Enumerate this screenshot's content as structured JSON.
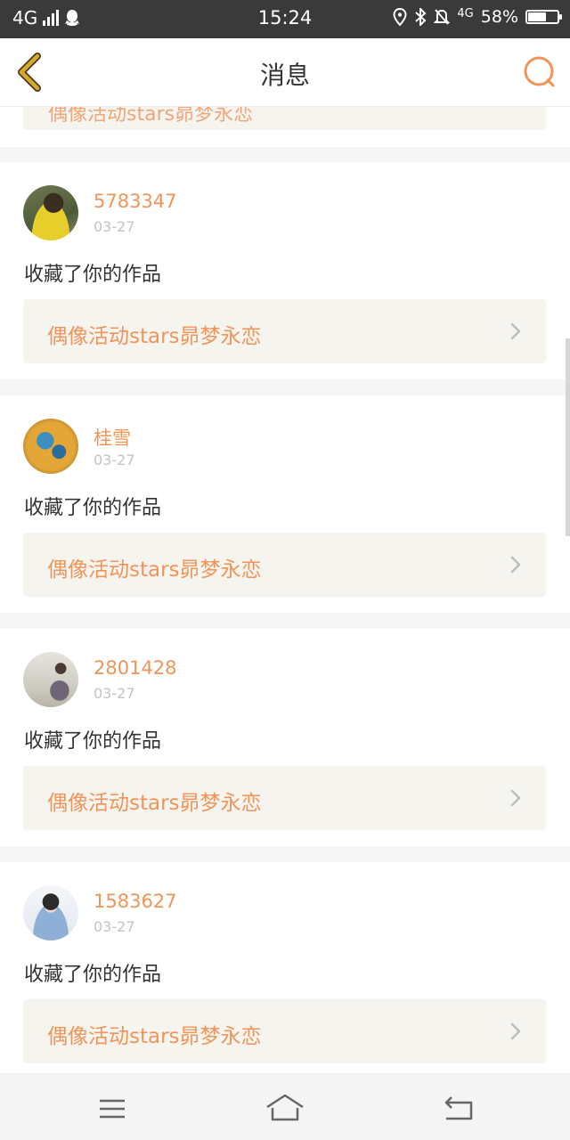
{
  "status_bar": {
    "network": "4G",
    "time": "15:24",
    "network_right": "4G",
    "battery": "58%",
    "battery_level": 0.58,
    "icons": [
      "signal-icon",
      "qq-icon",
      "location-icon",
      "bluetooth-icon",
      "bell-off-icon",
      "battery-icon"
    ]
  },
  "nav": {
    "title": "消息",
    "back_icon": "chevron-left-icon",
    "search_icon": "search-icon"
  },
  "partial_item": {
    "link_text": "偶像活动stars昴梦永恋"
  },
  "messages": [
    {
      "username": "5783347",
      "date": "03-27",
      "action": "收藏了你的作品",
      "link": "偶像活动stars昴梦永恋"
    },
    {
      "username": "桂雪",
      "date": "03-27",
      "action": "收藏了你的作品",
      "link": "偶像活动stars昴梦永恋"
    },
    {
      "username": "2801428",
      "date": "03-27",
      "action": "收藏了你的作品",
      "link": "偶像活动stars昴梦永恋"
    },
    {
      "username": "1583627",
      "date": "03-27",
      "action": "收藏了你的作品",
      "link": "偶像活动stars昴梦永恋"
    }
  ],
  "colors": {
    "accent": "#f0955a",
    "link_bg": "#f5f4ee",
    "back_icon": "#d4a92c"
  },
  "system_nav": [
    "menu-icon",
    "home-icon",
    "back-icon"
  ]
}
